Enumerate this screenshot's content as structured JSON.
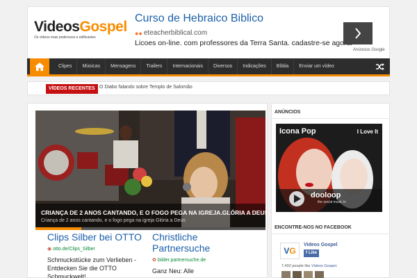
{
  "header": {
    "logo": {
      "word1": "Videos",
      "word2": "Gospel",
      "tagline": "Os vídeos mais poderosos e edificantes"
    },
    "ad": {
      "title": "Curso de Hebraico Biblico",
      "url": "eteacherbiblical.com",
      "description": "Licoes on-line. com professores da Terra Santa. cadastre-se agora!",
      "attribution": "Anúncios Google",
      "arrow_icon": "chevron-right-icon"
    }
  },
  "nav": {
    "home_icon": "home-icon",
    "items": [
      "Clipes",
      "Músicas",
      "Mensagens",
      "Trailers",
      "Internacionais",
      "Diversos",
      "Indicações",
      "Bíblia",
      "Enviar um vídeo"
    ],
    "shuffle_icon": "shuffle-icon"
  },
  "recent": {
    "label": "VÍDEOS RECENTES",
    "item": "O Diabo falando sobre Templo de Salomão"
  },
  "slider": {
    "title": "CRIANÇA DE 2 ANOS CANTANDO, E O FOGO PEGA NA IGREJA.GLÓRIA A DEUS",
    "description": "Criança de 2 anos cantando, e o fogo pega na igreja Glória a Deus",
    "progress": 0.2
  },
  "ads": [
    {
      "title": "Clips Silber bei OTTO",
      "url": "otto.de/Clips_Silber",
      "text": "Schmuckstücke zum Verlieben - Entdecken Sie die OTTO Schmuckwelt!"
    },
    {
      "title": "Christliche Partnersuche",
      "url": "bilder.partnersuche.de",
      "text": "Ganz Neu: Alle"
    }
  ],
  "sidebar": {
    "ads_title": "ANÚNCIOS",
    "banner": {
      "artist": "Icona Pop",
      "song": "I Love It",
      "brand": "dooloop",
      "brand_tagline": "the social music tv"
    },
    "facebook_title": "ENCONTRE-NOS NO FACEBOOK",
    "facebook": {
      "logo_v": "V",
      "logo_g": "G",
      "page_name": "Videos Gospel",
      "like_label": "Like",
      "count_text": "7,492 people like",
      "count_link": "Videos Gospel."
    }
  },
  "colors": {
    "accent": "#f88c00",
    "nav_bg": "#2d2d2d",
    "recent_red": "#c51111",
    "link_blue": "#1a5faa",
    "url_green": "#078a36",
    "facebook_blue": "#3b5998"
  }
}
